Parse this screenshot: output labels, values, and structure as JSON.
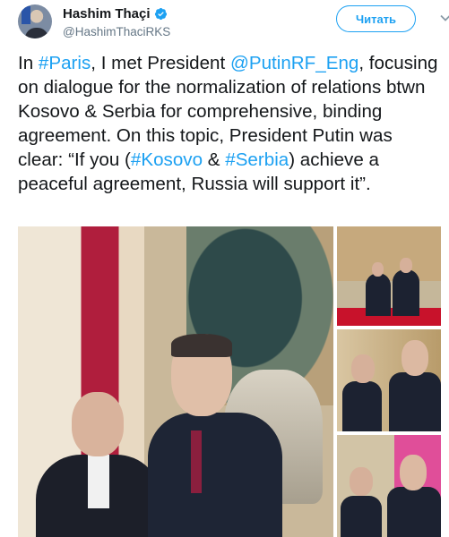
{
  "header": {
    "display_name": "Hashim Thaçi",
    "handle": "@HashimThaciRKS",
    "follow_label": "Читать"
  },
  "tweet": {
    "segments": [
      {
        "text": "In ",
        "link": false
      },
      {
        "text": "#Paris",
        "link": true
      },
      {
        "text": ", I met President ",
        "link": false
      },
      {
        "text": "@PutinRF_Eng",
        "link": true
      },
      {
        "text": ", focusing on dialogue for the normalization of relations btwn Kosovo & Serbia for comprehensive, binding agreement. On this topic, President Putin was clear: “If you (",
        "link": false
      },
      {
        "text": "#Kosovo",
        "link": true
      },
      {
        "text": " & ",
        "link": false
      },
      {
        "text": "#Serbia",
        "link": true
      },
      {
        "text": ") achieve a peaceful agreement, Russia will support it”.",
        "link": false
      }
    ]
  },
  "colors": {
    "accent": "#1da1f2",
    "text": "#14171a",
    "muted": "#657786"
  },
  "icons": {
    "verified": "verified-badge-icon",
    "caret": "chevron-down-icon"
  }
}
